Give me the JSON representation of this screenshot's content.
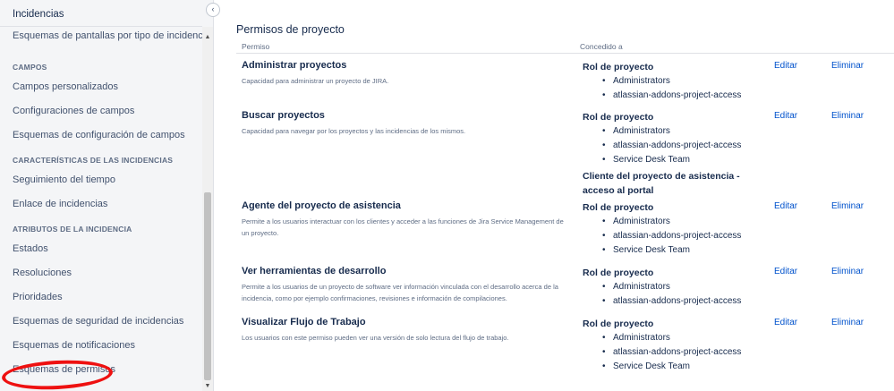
{
  "sidebar": {
    "header": "Incidencias",
    "top_item": "Esquemas de pantallas por tipo de incidencia",
    "sections": [
      {
        "title": "CAMPOS",
        "items": [
          "Campos personalizados",
          "Configuraciones de campos",
          "Esquemas de configuración de campos"
        ]
      },
      {
        "title": "CARACTERÍSTICAS DE LAS INCIDENCIAS",
        "items": [
          "Seguimiento del tiempo",
          "Enlace de incidencias"
        ]
      },
      {
        "title": "ATRIBUTOS DE LA INCIDENCIA",
        "items": [
          "Estados",
          "Resoluciones",
          "Prioridades",
          "Esquemas de seguridad de incidencias",
          "Esquemas de notificaciones",
          "Esquemas de permisos"
        ]
      }
    ]
  },
  "main": {
    "title": "Permisos de proyecto",
    "columns": {
      "permiso": "Permiso",
      "concedido": "Concedido a"
    },
    "actions": {
      "edit": "Editar",
      "delete": "Eliminar"
    },
    "permissions": [
      {
        "name": "Administrar proyectos",
        "description": "Capacidad para administrar un proyecto de JIRA.",
        "grant_title": "Rol de proyecto",
        "grants": [
          "Administrators",
          "atlassian-addons-project-access"
        ],
        "extra_grant": ""
      },
      {
        "name": "Buscar proyectos",
        "description": "Capacidad para navegar por los proyectos y las incidencias de los mismos.",
        "grant_title": "Rol de proyecto",
        "grants": [
          "Administrators",
          "atlassian-addons-project-access",
          "Service Desk Team"
        ],
        "extra_grant": "Cliente del proyecto de asistencia - acceso al portal"
      },
      {
        "name": "Agente del proyecto de asistencia",
        "description": "Permite a los usuarios interactuar con los clientes y acceder a las funciones de Jira Service Management de un proyecto.",
        "grant_title": "Rol de proyecto",
        "grants": [
          "Administrators",
          "atlassian-addons-project-access",
          "Service Desk Team"
        ],
        "extra_grant": ""
      },
      {
        "name": "Ver herramientas de desarrollo",
        "description": "Permite a los usuarios de un proyecto de software ver información vinculada con el desarrollo acerca de la incidencia, como por ejemplo confirmaciones, revisiones e información de compilaciones.",
        "grant_title": "Rol de proyecto",
        "grants": [
          "Administrators",
          "atlassian-addons-project-access"
        ],
        "extra_grant": ""
      },
      {
        "name": "Visualizar Flujo de Trabajo",
        "description": "Los usuarios con este permiso pueden ver una versión de solo lectura del flujo de trabajo.",
        "grant_title": "Rol de proyecto",
        "grants": [
          "Administrators",
          "atlassian-addons-project-access",
          "Service Desk Team"
        ],
        "extra_grant": ""
      }
    ]
  },
  "icons": {
    "collapse": "chevron-left-icon",
    "scroll_up": "arrow-up-icon",
    "scroll_down": "arrow-down-icon"
  },
  "colors": {
    "link": "#0052cc",
    "annotation": "#ee1111",
    "sidebar_bg": "#f4f5f7"
  }
}
